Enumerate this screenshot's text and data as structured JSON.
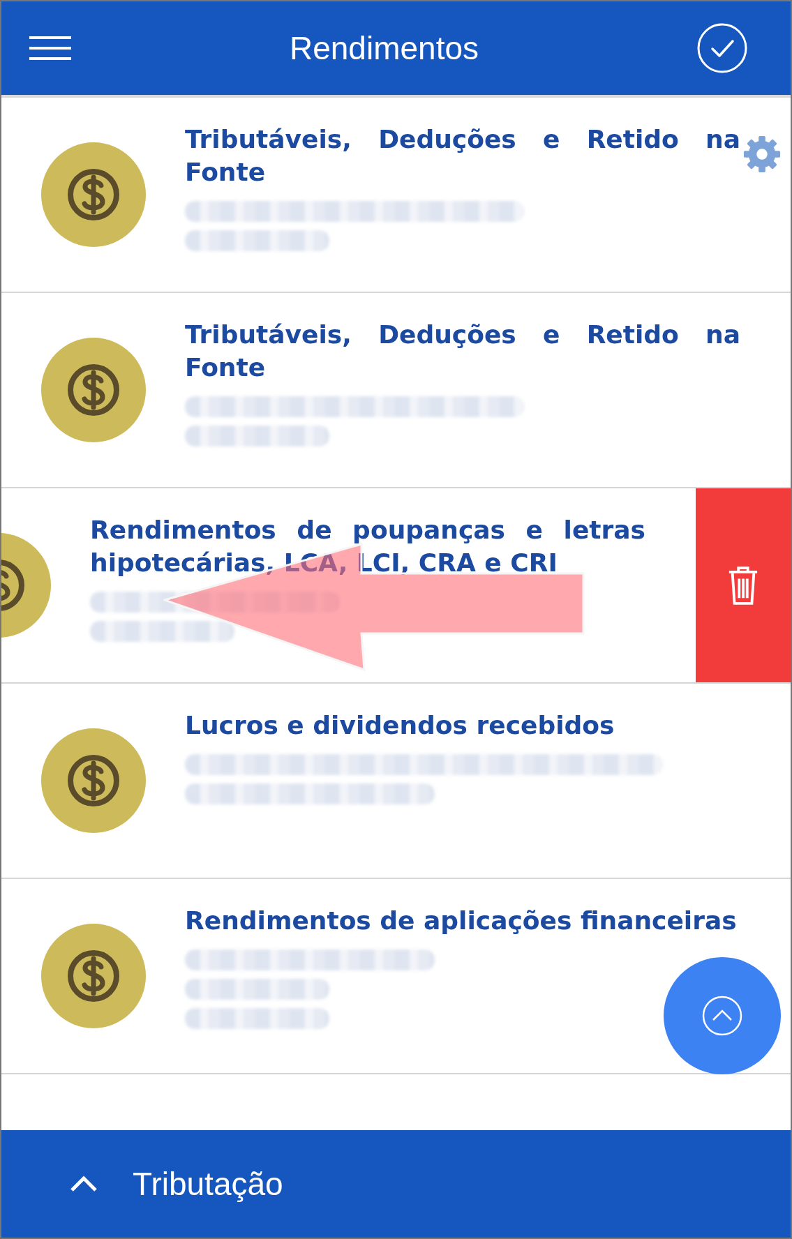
{
  "header": {
    "title": "Rendimentos"
  },
  "items": [
    {
      "title": "Tributáveis, Deduções e Retido na Fonte",
      "settings_icon": true,
      "swiped": false,
      "swipe_hint": false,
      "detail_lines": [
        {
          "kind": "long"
        },
        {
          "kind": "short"
        }
      ]
    },
    {
      "title": "Tributáveis, Deduções e Retido na Fonte",
      "settings_icon": false,
      "swiped": false,
      "swipe_hint": false,
      "detail_lines": [
        {
          "kind": "long"
        },
        {
          "kind": "short"
        }
      ]
    },
    {
      "title": "Rendimentos de poupanças e letras hipotecárias, LCA, LCI, CRA e CRI",
      "settings_icon": false,
      "swiped": true,
      "swipe_hint": true,
      "detail_lines": [
        {
          "kind": "medium"
        },
        {
          "kind": "short"
        }
      ]
    },
    {
      "title": "Lucros e dividendos recebidos",
      "settings_icon": false,
      "swiped": false,
      "swipe_hint": false,
      "detail_lines": [
        {
          "kind": "full"
        },
        {
          "kind": "medium"
        }
      ]
    },
    {
      "title": "Rendimentos de aplicações financeiras",
      "settings_icon": false,
      "swiped": false,
      "swipe_hint": false,
      "detail_lines": [
        {
          "kind": "medium"
        },
        {
          "kind": "short"
        },
        {
          "kind": "short"
        }
      ]
    }
  ],
  "footer": {
    "label": "Tributação"
  }
}
